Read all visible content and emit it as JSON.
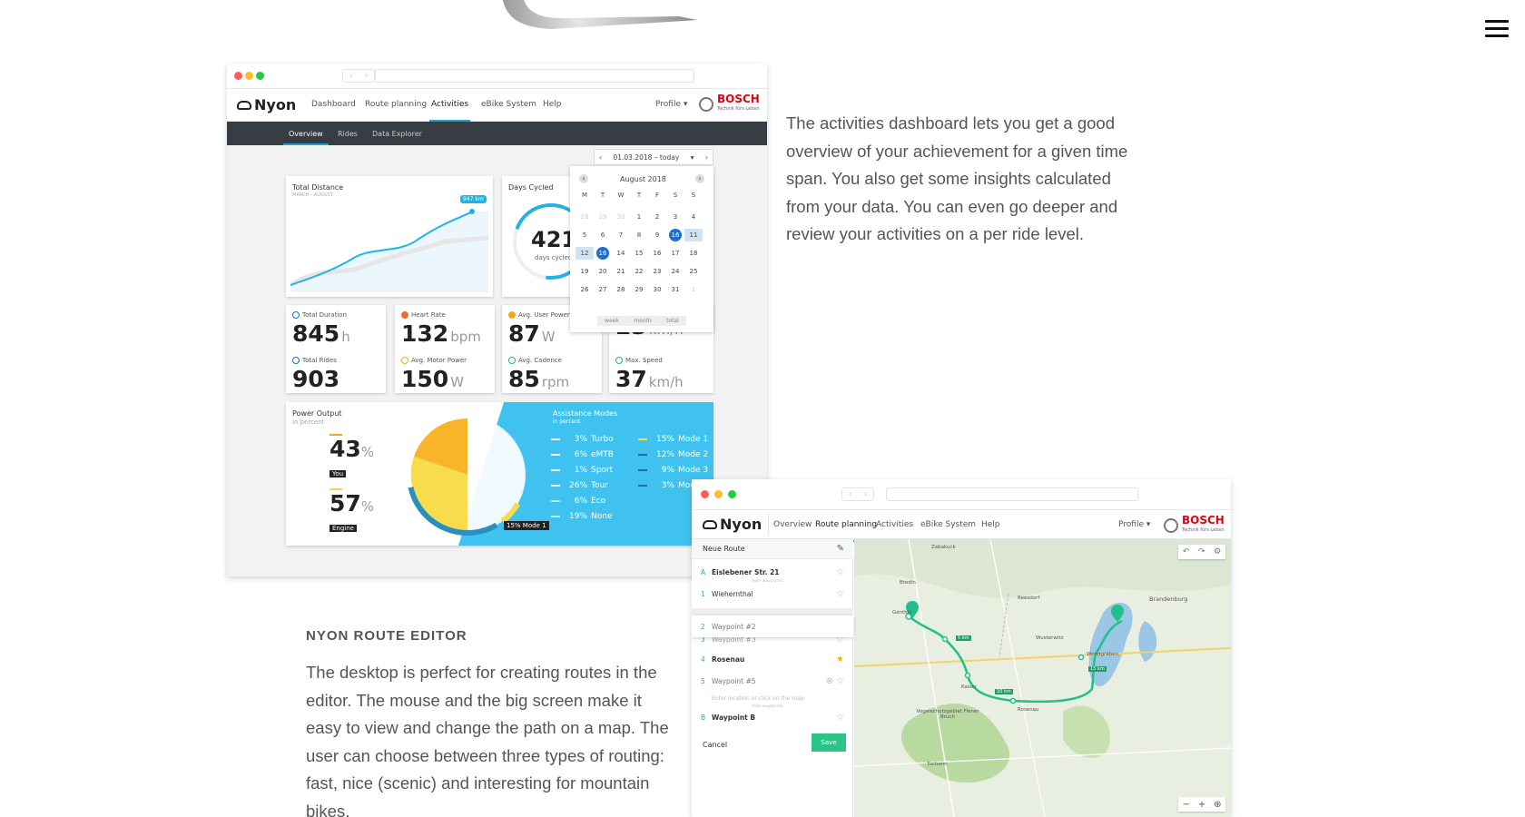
{
  "menu": {
    "icon": "hamburger-icon"
  },
  "activities_window": {
    "logo": "Nyon",
    "nav": [
      "Dashboard",
      "Route planning",
      "Activities",
      "eBike System",
      "Help"
    ],
    "profile": "Profile",
    "brand": "BOSCH",
    "brand_sub": "Technik fürs Leben",
    "subnav": [
      "Overview",
      "Rides",
      "Data Explorer"
    ],
    "date_range": "01.03.2018 – today",
    "total_distance": {
      "title": "Total Distance",
      "subtitle": "MARCH – AUGUST",
      "badge": "947 km"
    },
    "days_cycled": {
      "title": "Days Cycled",
      "value": "421",
      "label": "days cycled"
    },
    "calendar": {
      "month": "August 2018",
      "weekdays": [
        "M",
        "T",
        "W",
        "T",
        "F",
        "S",
        "S"
      ],
      "rows": [
        [
          "28",
          "29",
          "30",
          "1",
          "2",
          "3",
          "4"
        ],
        [
          "5",
          "6",
          "7",
          "8",
          "9",
          "16",
          "11"
        ],
        [
          "12",
          "16",
          "14",
          "15",
          "16",
          "17",
          "18"
        ],
        [
          "19",
          "20",
          "21",
          "22",
          "23",
          "24",
          "25"
        ],
        [
          "26",
          "27",
          "28",
          "29",
          "30",
          "31",
          "1"
        ]
      ],
      "tabs": [
        "week",
        "month",
        "total"
      ]
    },
    "metrics": [
      {
        "label": "Total Duration",
        "value": "845",
        "unit": "h"
      },
      {
        "label": "Heart Rate",
        "value": "132",
        "unit": "bpm"
      },
      {
        "label": "Avg. User Power",
        "value": "87",
        "unit": "W"
      },
      {
        "label": "",
        "value": "23",
        "unit": "km/h"
      },
      {
        "label": "Total Rides",
        "value": "903",
        "unit": ""
      },
      {
        "label": "Avg. Motor Power",
        "value": "150",
        "unit": "W"
      },
      {
        "label": "Avg. Cadence",
        "value": "85",
        "unit": "rpm"
      },
      {
        "label": "Max. Speed",
        "value": "37",
        "unit": "km/h"
      }
    ],
    "power_output": {
      "title": "Power Output",
      "subtitle": "in percent",
      "you_value": "43",
      "you_label": "You",
      "engine_value": "57",
      "engine_label": "Engine",
      "tag": "15% Mode 1"
    },
    "assistance": {
      "title": "Assistance Modes",
      "subtitle": "in percent",
      "left": [
        {
          "pct": "3%",
          "name": "Turbo"
        },
        {
          "pct": "6%",
          "name": "eMTB"
        },
        {
          "pct": "1%",
          "name": "Sport"
        },
        {
          "pct": "26%",
          "name": "Tour"
        },
        {
          "pct": "6%",
          "name": "Eco"
        },
        {
          "pct": "19%",
          "name": "None"
        }
      ],
      "right": [
        {
          "pct": "15%",
          "name": "Mode 1"
        },
        {
          "pct": "12%",
          "name": "Mode 2"
        },
        {
          "pct": "9%",
          "name": "Mode 3"
        },
        {
          "pct": "3%",
          "name": "Mode"
        }
      ]
    }
  },
  "desc1": "The activities dashboard lets you get a good overview of your achievement for a given time span. You also get some insights calculated from your data. You can even go deeper and review your activities on a per ride level.",
  "route_heading": "NYON ROUTE EDITOR",
  "desc2": "The desktop is perfect for creating routes in the editor. The mouse and the big screen make it easy to view and change the path on a map. The user can choose between three types of routing: fast, nice (scenic) and interesting for mountain bikes.",
  "route_window": {
    "logo": "Nyon",
    "nav": [
      "Overview",
      "Route planning",
      "Activities",
      "eBike System",
      "Help"
    ],
    "profile": "Profile",
    "brand": "BOSCH",
    "brand_sub": "Technik fürs Leben",
    "route_title": "Neue Route",
    "items": [
      {
        "idx": "A",
        "name": "Eislebener Str. 21"
      },
      {
        "idx": "1",
        "name": "Wiehernthal"
      },
      {
        "idx": "2",
        "name": "Waypoint #2"
      },
      {
        "idx": "3",
        "name": "Waypoint #3"
      },
      {
        "idx": "4",
        "name": "Rosenau"
      },
      {
        "idx": "5",
        "name": "Waypoint #5"
      },
      {
        "idx": "B",
        "name": "Waypoint B"
      }
    ],
    "hide_waypoints": "Hide waypoints",
    "enter_placeholder": "Enter location or click on the map",
    "cancel": "Cancel",
    "save": "Save",
    "map_labels": [
      "Zabakuck",
      "Bredin",
      "Genthin",
      "Brandenburg",
      "Reesdorf",
      "Wusterwitz",
      "Wendgräben",
      "Vogelschutzgebiet Fiener Bruch",
      "Tucheim",
      "Rosenau",
      "Kaiser"
    ],
    "distance_tags": [
      "5 km",
      "10 km",
      "15 km",
      "20 km"
    ]
  }
}
